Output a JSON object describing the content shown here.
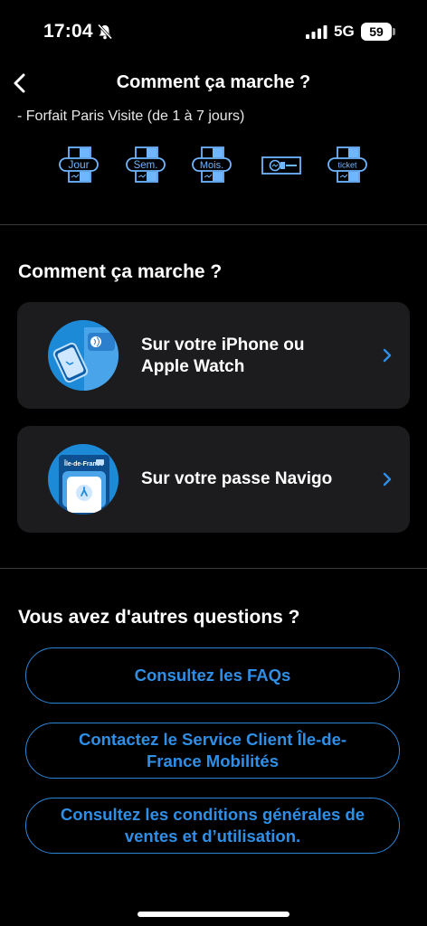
{
  "status_bar": {
    "time": "17:04",
    "network": "5G",
    "battery": "59"
  },
  "header": {
    "title": "Comment ça marche ?",
    "subtitle": "- Forfait Paris Visite (de 1 à 7 jours)"
  },
  "ticket_icons": [
    {
      "label": "Jour",
      "icon": "pass-day-icon"
    },
    {
      "label": "Sem.",
      "icon": "pass-week-icon"
    },
    {
      "label": "Mois.",
      "icon": "pass-month-icon"
    },
    {
      "label": "",
      "icon": "card-icon"
    },
    {
      "label": "ticket",
      "icon": "ticket-icon"
    }
  ],
  "how_section": {
    "title": "Comment ça marche ?",
    "cards": [
      {
        "line1": "Sur votre iPhone ou",
        "line2": "Apple Watch",
        "icon": "iphone-watch-icon"
      },
      {
        "line1": "Sur votre passe Navigo",
        "line2": "",
        "icon": "navigo-pass-icon",
        "pass_brand": "Île-de-France"
      }
    ]
  },
  "questions_section": {
    "title": "Vous avez d'autres questions ?",
    "buttons": [
      {
        "line1": "Consultez les FAQs",
        "line2": ""
      },
      {
        "line1": "Contactez le Service Client Île-de-",
        "line2": "France Mobilités"
      },
      {
        "line1": "Consultez les conditions générales de",
        "line2": "ventes et d’utilisation."
      }
    ]
  },
  "colors": {
    "accent": "#2f8fe6",
    "card_bg": "#1c1c1e",
    "icon_bg": "#1d8ad8",
    "background": "#000000"
  }
}
